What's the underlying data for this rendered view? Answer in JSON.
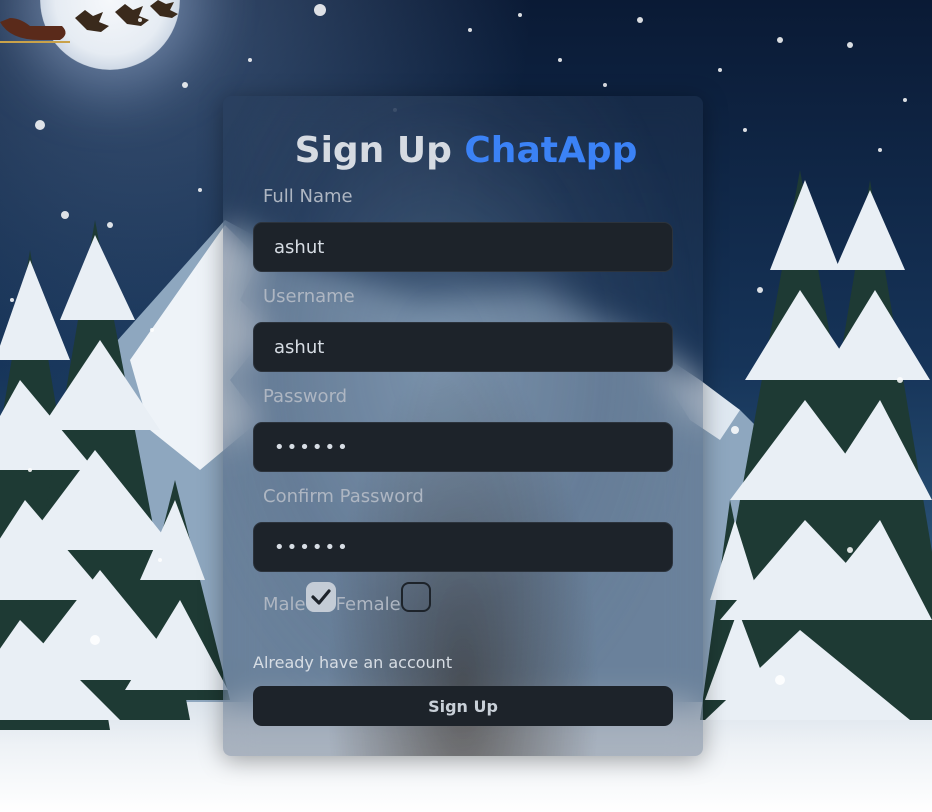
{
  "header": {
    "title_prefix": "Sign Up",
    "title_brand": "ChatApp"
  },
  "form": {
    "full_name": {
      "label": "Full Name",
      "value": "ashut"
    },
    "username": {
      "label": "Username",
      "value": "ashut"
    },
    "password": {
      "label": "Password",
      "value": "••••••"
    },
    "confirm_password": {
      "label": "Confirm Password",
      "value": "••••••"
    },
    "gender": {
      "male_label": "Male",
      "female_label": "Female",
      "male_checked": true,
      "female_checked": false
    },
    "login_link": "Already have an account",
    "submit_label": "Sign Up"
  },
  "colors": {
    "brand": "#3b82f6",
    "input_bg": "#1d232a",
    "label": "#aeb6c2"
  }
}
